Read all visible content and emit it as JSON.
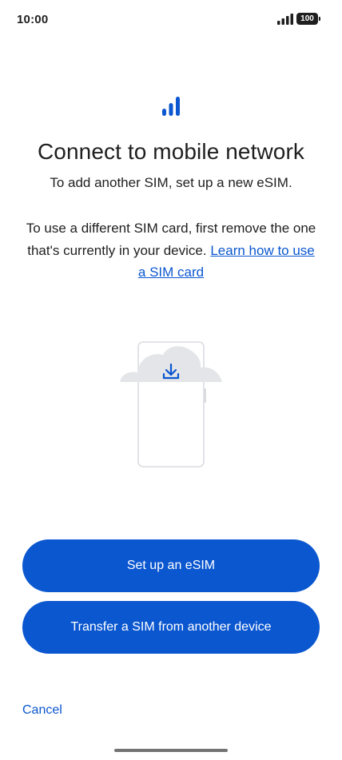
{
  "status_bar": {
    "time": "10:00",
    "signal_icon": "cellular-signal-icon",
    "battery_level": "100"
  },
  "header": {
    "icon": "signal-bars-icon",
    "title": "Connect to mobile network",
    "subtitle": "To add another SIM, set up a new eSIM."
  },
  "body": {
    "text": "To use a different SIM card, first remove the one that's currently in your device. ",
    "link_label": "Learn how to use a SIM card"
  },
  "illustration": {
    "icons": [
      "phone-outline-icon",
      "cloud-icon",
      "download-icon"
    ]
  },
  "actions": {
    "setup_esim_label": "Set up an eSIM",
    "transfer_sim_label": "Transfer a SIM from another device",
    "cancel_label": "Cancel"
  },
  "colors": {
    "accent": "#0b57d0",
    "text": "#1f1f1f",
    "background": "#ffffff",
    "illustration_gray": "#dfe1e5"
  }
}
